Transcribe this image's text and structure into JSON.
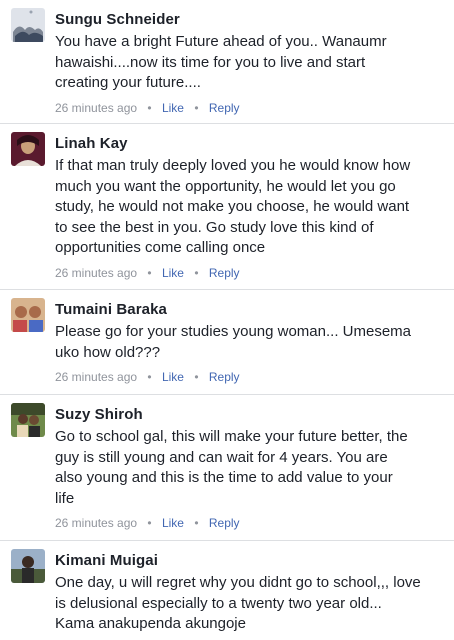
{
  "comments": [
    {
      "author": "Sungu Schneider",
      "lines": [
        "You have a bright Future ahead of you.. Wanaumr",
        "hawaishi....now its time for you to live and start",
        "creating your future...."
      ],
      "time": "26 minutes ago",
      "like": "Like",
      "reply": "Reply",
      "avatar_colors": [
        "#dfe3ea",
        "#7d8694",
        "#3d4a5f"
      ]
    },
    {
      "author": "Linah Kay",
      "lines": [
        "If that man truly deeply loved you he would know how",
        "much you want the opportunity, he would let you go",
        "study, he would not make you choose, he would want",
        "to see the best in you. Go study love this kind of",
        "opportunities come calling once"
      ],
      "time": "26 minutes ago",
      "like": "Like",
      "reply": "Reply",
      "avatar_colors": [
        "#5a1a2e",
        "#c8a07a",
        "#2b0f18"
      ]
    },
    {
      "author": "Tumaini Baraka",
      "lines": [
        "Please go for your studies young woman... Umesema",
        "uko how old???"
      ],
      "time": "26 minutes ago",
      "like": "Like",
      "reply": "Reply",
      "avatar_colors": [
        "#d8b48e",
        "#a86a4a",
        "#c44a4a"
      ]
    },
    {
      "author": "Suzy Shiroh",
      "lines": [
        "Go to school gal, this will make your future better,  the",
        "guy is still young and can wait for 4 years. You are",
        "also young and this is the time to add value to your",
        "life"
      ],
      "time": "26 minutes ago",
      "like": "Like",
      "reply": "Reply",
      "avatar_colors": [
        "#6f8a4a",
        "#3d4a2a",
        "#e8d8b8"
      ]
    },
    {
      "author": "Kimani Muigai",
      "lines": [
        "One day, u will regret why you didnt go to school,,, love",
        "is delusional especially to a twenty two year old...",
        "Kama anakupenda akungoje"
      ],
      "time": "",
      "like": "",
      "reply": "",
      "avatar_colors": [
        "#9bb0c8",
        "#4a5a3a",
        "#2a2a2a"
      ]
    }
  ],
  "separator": "•"
}
